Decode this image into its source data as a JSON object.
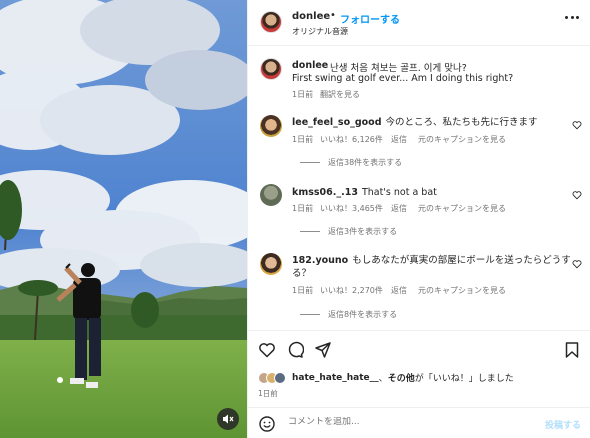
{
  "post": {
    "username": "donlee",
    "follow_label": "フォローする",
    "audio_label": "オリジナル音源",
    "caption_ko": "난생 처음 쳐보는 골프. 이게 맞나?",
    "caption_en": "First swing at golf ever... Am I doing this right?",
    "caption_time": "1日前",
    "see_translation": "翻訳を見る"
  },
  "comments": [
    {
      "username": "lee_feel_so_good",
      "text": "今のところ、私たちも先に行きます",
      "time": "1日前",
      "likes": "いいね！6,126件",
      "reply": "返信",
      "see_original": "元のキャプションを見る",
      "view_replies": "返信38件を表示する"
    },
    {
      "username": "kmss06._.13",
      "text": "That's not a bat",
      "time": "1日前",
      "likes": "いいね！3,465件",
      "reply": "返信",
      "see_original": "元のキャプションを見る",
      "view_replies": "返信3件を表示する"
    },
    {
      "username": "182.youno",
      "text": "もしあなたが真実の部屋にボールを送ったらどうする？",
      "time": "1日前",
      "likes": "いいね！2,270件",
      "reply": "返信",
      "see_original": "元のキャプションを見る",
      "view_replies": "返信8件を表示する"
    }
  ],
  "likes_summary": {
    "user": "hate_hate_hate__",
    "separator": "、",
    "others": "その他",
    "suffix": "が「いいね！」しました"
  },
  "post_date": "1日前",
  "comment_box": {
    "placeholder": "コメントを追加...",
    "post_label": "投稿する"
  },
  "icons": {
    "like": "heart-icon",
    "comment": "comment-icon",
    "share": "share-icon",
    "save": "bookmark-icon",
    "emoji": "emoji-icon",
    "mute": "mute-icon",
    "more": "more-icon"
  },
  "colors": {
    "follow": "#0095f6",
    "post_disabled": "#b2dffc",
    "muted_text": "#737373"
  }
}
